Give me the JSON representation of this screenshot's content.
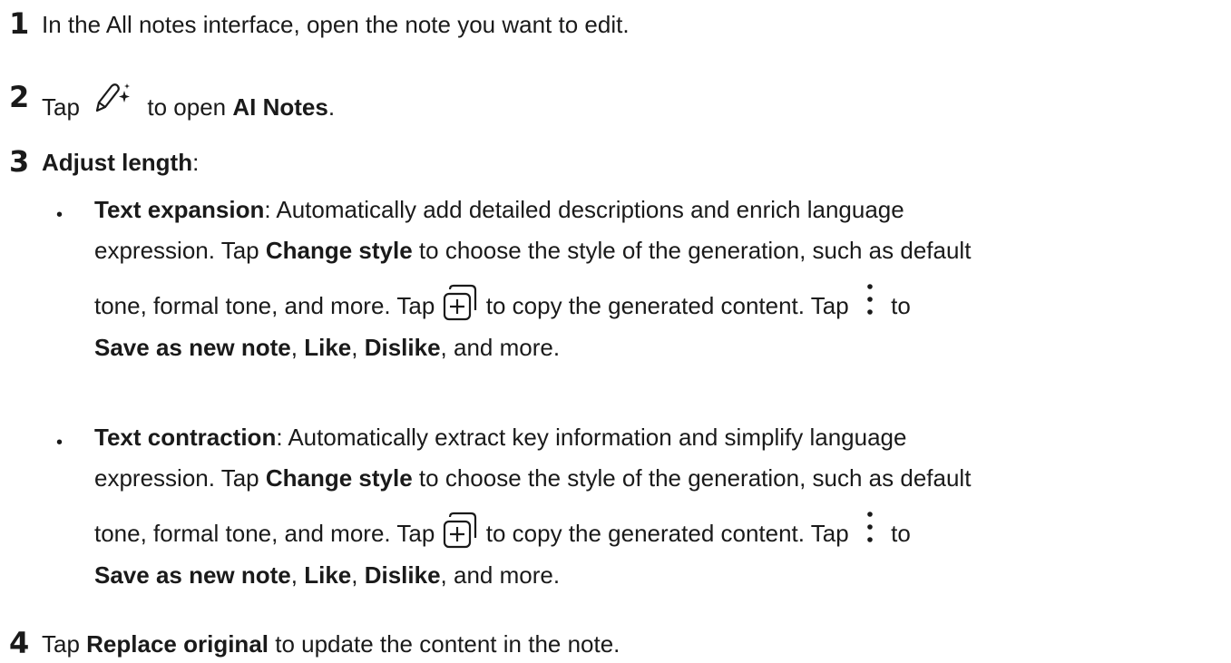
{
  "steps": [
    {
      "number": "1",
      "text": "In the All notes interface, open the note you want to edit."
    },
    {
      "number": "2",
      "pre": "Tap",
      "icon": "ai-pen-sparkle-icon",
      "mid": "to open",
      "bold": "AI Notes",
      "post": "."
    },
    {
      "number": "3",
      "bold": "Adjust length",
      "post": ":",
      "bullets": [
        {
          "marker": "•",
          "title": "Text expansion",
          "line1": ": Automatically add detailed descriptions and enrich language",
          "line2_a": "expression. Tap ",
          "line2_bold": "Change style",
          "line2_b": " to choose the style of the generation, such as default",
          "line3_a": "tone, formal tone, and more. Tap ",
          "copy_icon": "copy-add-icon",
          "line3_b": " to copy the generated content. Tap ",
          "more_icon": "more-vertical-icon",
          "line3_c": " to",
          "line4_bold1": "Save as new note",
          "sep1": ", ",
          "line4_bold2": "Like",
          "sep2": ", ",
          "line4_bold3": "Dislike",
          "line4_end": ", and more."
        },
        {
          "marker": "•",
          "title": "Text contraction",
          "line1": ": Automatically extract key information and simplify language",
          "line2_a": "expression. Tap ",
          "line2_bold": "Change style",
          "line2_b": " to choose the style of the generation, such as default",
          "line3_a": "tone, formal tone, and more. Tap ",
          "copy_icon": "copy-add-icon",
          "line3_b": " to copy the generated content. Tap ",
          "more_icon": "more-vertical-icon",
          "line3_c": " to",
          "line4_bold1": "Save as new note",
          "sep1": ", ",
          "line4_bold2": "Like",
          "sep2": ", ",
          "line4_bold3": "Dislike",
          "line4_end": ", and more."
        }
      ]
    },
    {
      "number": "4",
      "pre": "Tap ",
      "bold": "Replace original",
      "post": " to update the content in the note."
    }
  ]
}
